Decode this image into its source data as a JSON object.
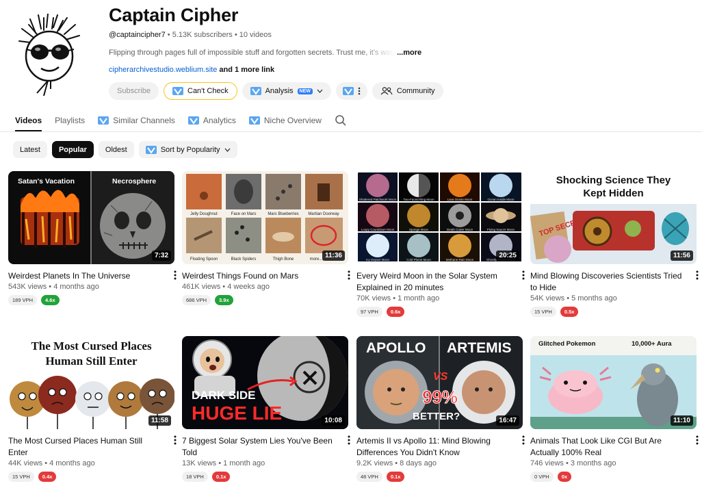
{
  "channel": {
    "name": "Captain Cipher",
    "handle": "@captaincipher7",
    "subscribers": "5.13K subscribers",
    "videos": "10 videos",
    "description": "Flipping through pages full of impossible stuff and forgotten secrets. Trust me, it's way",
    "more": "...more",
    "link_url": "cipherarchivestudio.weblium.site",
    "link_more": "and 1 more link"
  },
  "actions": {
    "subscribe": "Subscribe",
    "cant_check": "Can't Check",
    "analysis": "Analysis",
    "analysis_badge": "NEW",
    "community": "Community"
  },
  "tabs": [
    "Videos",
    "Playlists",
    "Similar Channels",
    "Analytics",
    "Niche Overview"
  ],
  "filters": {
    "latest": "Latest",
    "popular": "Popular",
    "oldest": "Oldest",
    "sort": "Sort by Popularity"
  },
  "videos": [
    {
      "title": "Weirdest Planets In The Universe",
      "meta": "543K views • 4 months ago",
      "duration": "7:32",
      "vph": "189 VPH",
      "mult": "4.6x",
      "mult_color": "#22a33a"
    },
    {
      "title": "Weirdest Things Found on Mars",
      "meta": "461K views • 4 weeks ago",
      "duration": "11:36",
      "vph": "686 VPH",
      "mult": "3.9x",
      "mult_color": "#22a33a"
    },
    {
      "title": "Every Weird Moon in the Solar System Explained in 20 minutes",
      "meta": "70K views • 1 month ago",
      "duration": "20:25",
      "vph": "97 VPH",
      "mult": "0.6x",
      "mult_color": "#e33b3b"
    },
    {
      "title": "Mind Blowing Discoveries Scientists Tried to Hide",
      "meta": "54K views • 5 months ago",
      "duration": "11:56",
      "vph": "15 VPH",
      "mult": "0.5x",
      "mult_color": "#e33b3b"
    },
    {
      "title": "The Most Cursed Places Human Still Enter",
      "meta": "44K views • 4 months ago",
      "duration": "11:58",
      "vph": "15 VPH",
      "mult": "0.4x",
      "mult_color": "#e33b3b"
    },
    {
      "title": "7 Biggest Solar System Lies You've Been Told",
      "meta": "13K views • 1 month ago",
      "duration": "10:08",
      "vph": "18 VPH",
      "mult": "0.1x",
      "mult_color": "#e33b3b"
    },
    {
      "title": "Artemis II vs Apollo 11: Mind Blowing Differences You Didn't Know",
      "meta": "9.2K views • 8 days ago",
      "duration": "16:47",
      "vph": "48 VPH",
      "mult": "0.1x",
      "mult_color": "#e33b3b"
    },
    {
      "title": "Animals That Look Like CGI But Are Actually 100% Real",
      "meta": "746 views • 3 months ago",
      "duration": "11:10",
      "vph": "0 VPH",
      "mult": "0x",
      "mult_color": "#e33b3b"
    }
  ],
  "thumb_text": {
    "t1_left": "Satan's Vacation",
    "t1_right": "Necrosphere",
    "t2_labels": [
      "Jelly Doughnut",
      "Face on Mars",
      "Mars Blueberries",
      "Martian Doorway",
      "Floating Spoon",
      "Black Spiders",
      "Thigh Bone",
      "more..."
    ],
    "t3_labels": [
      "Shattered Patchwork Moon",
      "Two-Faced Ring Moon",
      "Lava Ocean Moon",
      "Ocean Inside Moon",
      "Loopy Countdown Moon",
      "Sponge Moon",
      "Death Crater Moon",
      "Flying Saucer Moon",
      "Icy Geyser Moon",
      "Cold Plume Moon",
      "Methane Rain Moon",
      "Ghostly Orbital Moon"
    ],
    "t4_title": "Shocking Science They Kept Hidden",
    "t4_stamp": "TOP SECRET",
    "t5_title": "The Most Cursed Places Human Still Enter",
    "t6_line1": "DARK SIDE",
    "t6_line2": "HUGE LIE",
    "t7_left": "APOLLO",
    "t7_right": "ARTEMIS",
    "t7_vs": "VS",
    "t7_pct": "99%",
    "t7_better": "BETTER?",
    "t8_left": "Glitched Pokemon",
    "t8_right": "10,000+ Aura"
  }
}
